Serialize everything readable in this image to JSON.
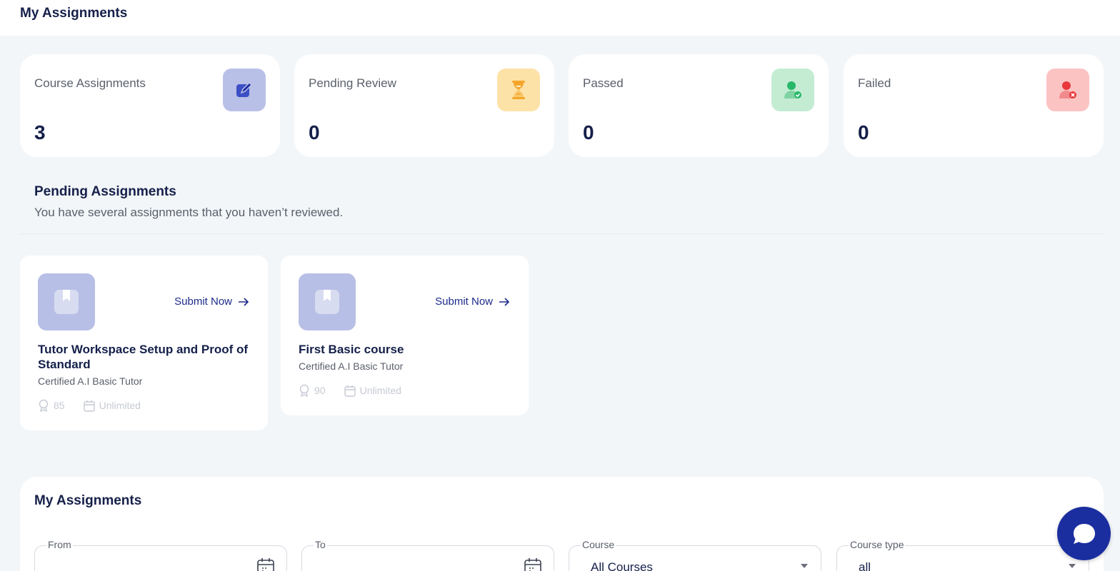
{
  "header": {
    "title": "My Assignments"
  },
  "stats": [
    {
      "label": "Course Assignments",
      "value": "3",
      "icon": "pencil-square-icon",
      "color": "#b9c0e8"
    },
    {
      "label": "Pending Review",
      "value": "0",
      "icon": "hourglass-icon",
      "color": "#fde2a8"
    },
    {
      "label": "Passed",
      "value": "0",
      "icon": "user-check-icon",
      "color": "#c4ecd3"
    },
    {
      "label": "Failed",
      "value": "0",
      "icon": "user-x-icon",
      "color": "#fcc3c3"
    }
  ],
  "pending": {
    "title": "Pending Assignments",
    "subtitle": "You have several assignments that you haven’t reviewed.",
    "cards": [
      {
        "submit_label": "Submit Now",
        "title": "Tutor Workspace Setup and Proof of Standard",
        "course": "Certified A.I Basic Tutor",
        "points": "85",
        "duration": "Unlimited"
      },
      {
        "submit_label": "Submit Now",
        "title": "First Basic course",
        "course": "Certified A.I Basic Tutor",
        "points": "90",
        "duration": "Unlimited"
      }
    ]
  },
  "my_assignments": {
    "title": "My Assignments",
    "filters": {
      "from_label": "From",
      "to_label": "To",
      "course_label": "Course",
      "course_value": "All Courses",
      "type_label": "Course type",
      "type_value": "all"
    }
  }
}
